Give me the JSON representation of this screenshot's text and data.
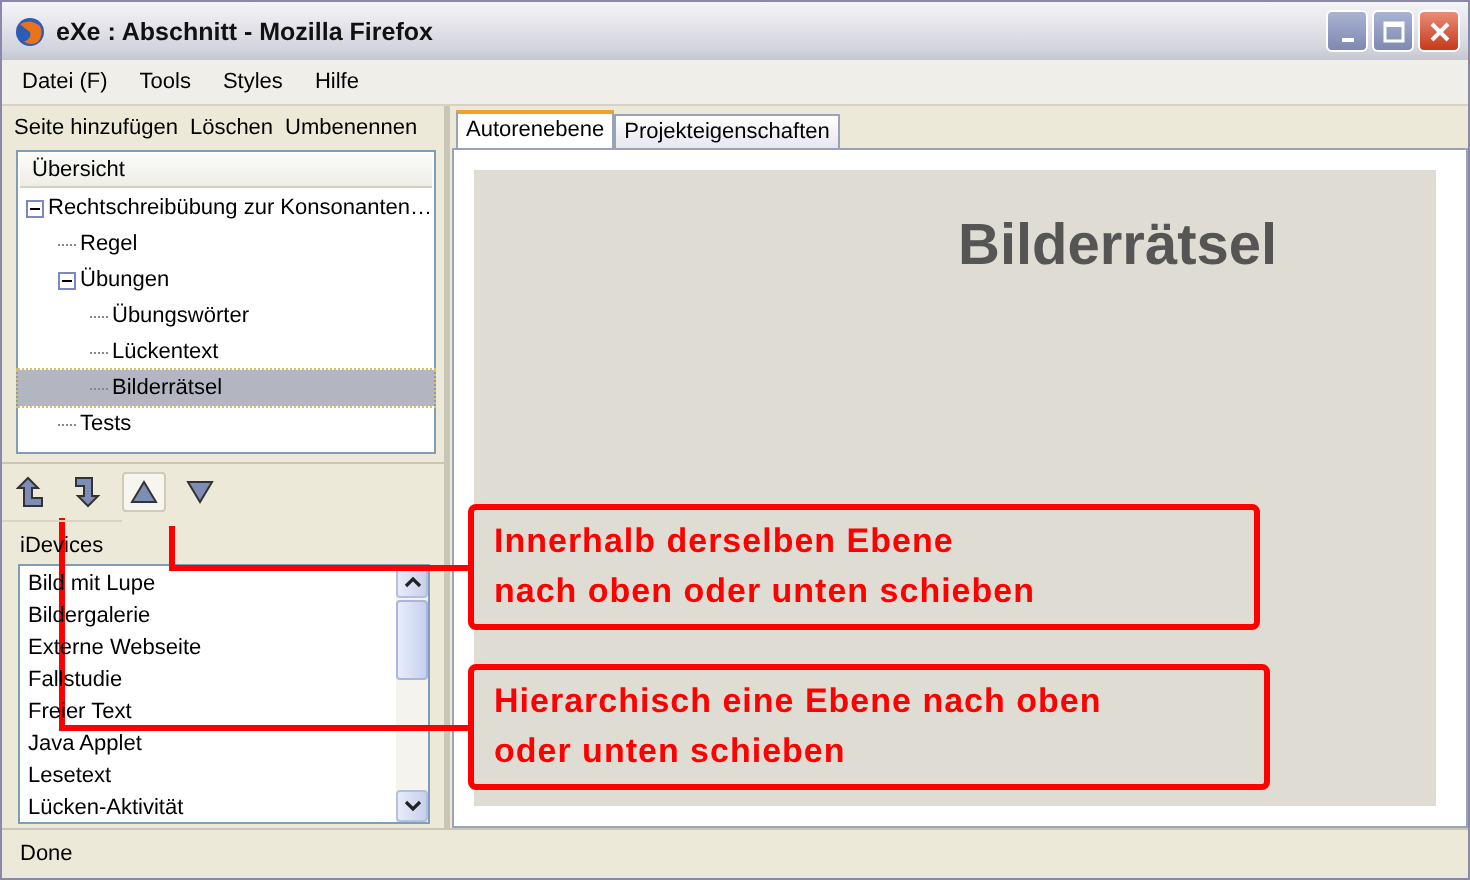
{
  "window": {
    "title": "eXe : Abschnitt - Mozilla Firefox"
  },
  "menu": [
    "Datei (F)",
    "Tools",
    "Styles",
    "Hilfe"
  ],
  "outline_toolbar": [
    "Seite hinzufügen",
    "Löschen",
    "Umbenennen"
  ],
  "outline": {
    "header": "Übersicht",
    "tree": [
      {
        "label": "Rechtschreibübung zur Konsonanten…",
        "expanded": true,
        "selected": false,
        "children": [
          {
            "label": "Regel",
            "selected": false
          },
          {
            "label": "Übungen",
            "expanded": true,
            "selected": false,
            "children": [
              {
                "label": "Übungswörter",
                "selected": false
              },
              {
                "label": "Lückentext",
                "selected": false
              },
              {
                "label": "Bilderrätsel",
                "selected": true
              }
            ]
          },
          {
            "label": "Tests",
            "selected": false
          }
        ]
      }
    ]
  },
  "move_buttons": [
    {
      "kind": "promote",
      "selected": false
    },
    {
      "kind": "demote",
      "selected": false
    },
    {
      "kind": "up",
      "selected": true
    },
    {
      "kind": "down",
      "selected": false
    }
  ],
  "idevices": {
    "label": "iDevices",
    "items": [
      "Bild mit Lupe",
      "Bildergalerie",
      "Externe Webseite",
      "Fallstudie",
      "Freier Text",
      "Java Applet",
      "Lesetext",
      "Lücken-Aktivität"
    ]
  },
  "tabs": [
    {
      "label": "Autorenebene",
      "selected": true
    },
    {
      "label": "Projekteigenschaften",
      "selected": false
    }
  ],
  "page_title": "Bilderrätsel",
  "callouts": [
    "Innerhalb derselben Ebene\nnach oben oder unten schieben",
    "Hierarchisch eine Ebene nach oben\noder unten schieben"
  ],
  "status_bar": "Done"
}
